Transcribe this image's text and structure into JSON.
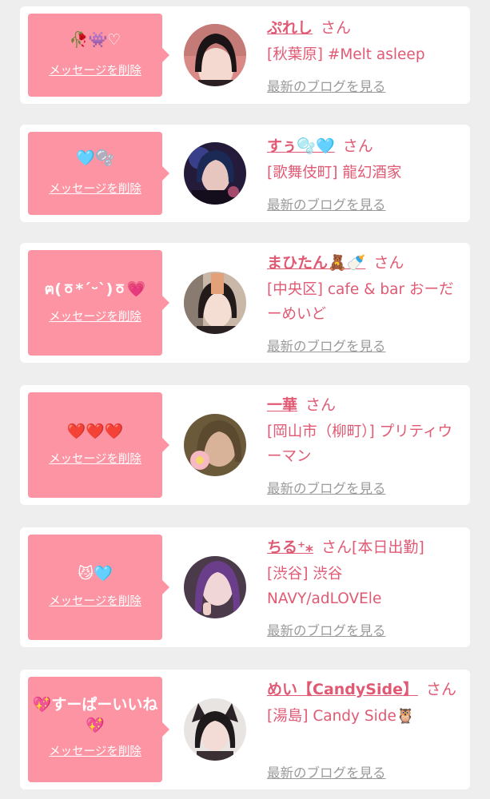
{
  "cards": [
    {
      "message": "🥀👾♡",
      "delete_label": "メッセージを削除",
      "name": "ぷれし",
      "san": "さん",
      "location": "[秋葉原] #Melt asleep",
      "blog_link": "最新のブログを見る"
    },
    {
      "message": "🩵🫧",
      "delete_label": "メッセージを削除",
      "name": "すぅ🫧🩵",
      "san": "さん",
      "location": "[歌舞伎町] 龍幻酒家",
      "blog_link": "最新のブログを見る"
    },
    {
      "message": "ฅ(ㆆ*ˊᵕˋ)ㆆ💗",
      "delete_label": "メッセージを削除",
      "name": "まひたん🧸🍼",
      "san": "さん",
      "location": "[中央区] cafe & bar おーだーめいど",
      "blog_link": "最新のブログを見る"
    },
    {
      "message": "❤️❤️❤️",
      "delete_label": "メッセージを削除",
      "name": "一華",
      "san": "さん",
      "location": "[岡山市（柳町）] プリティウーマン",
      "blog_link": "最新のブログを見る"
    },
    {
      "message": "😼🩵",
      "delete_label": "メッセージを削除",
      "name": "ちる⁺⁎",
      "san": "さん[本日出勤]",
      "location": "[渋谷] 渋谷 NAVY/adLOVEle",
      "blog_link": "最新のブログを見る"
    },
    {
      "message": "💖すーぱーいいね💖",
      "delete_label": "メッセージを削除",
      "name": "めい【CandySide】",
      "san": "さん",
      "location": "[湯島] Candy Side🦉",
      "blog_link": "最新のブログを見る"
    }
  ],
  "colors": {
    "accent": "#e05a74",
    "bubble": "#fc94a3",
    "background": "#eeeeee",
    "card": "#ffffff",
    "link_gray": "#9a9a9a"
  }
}
